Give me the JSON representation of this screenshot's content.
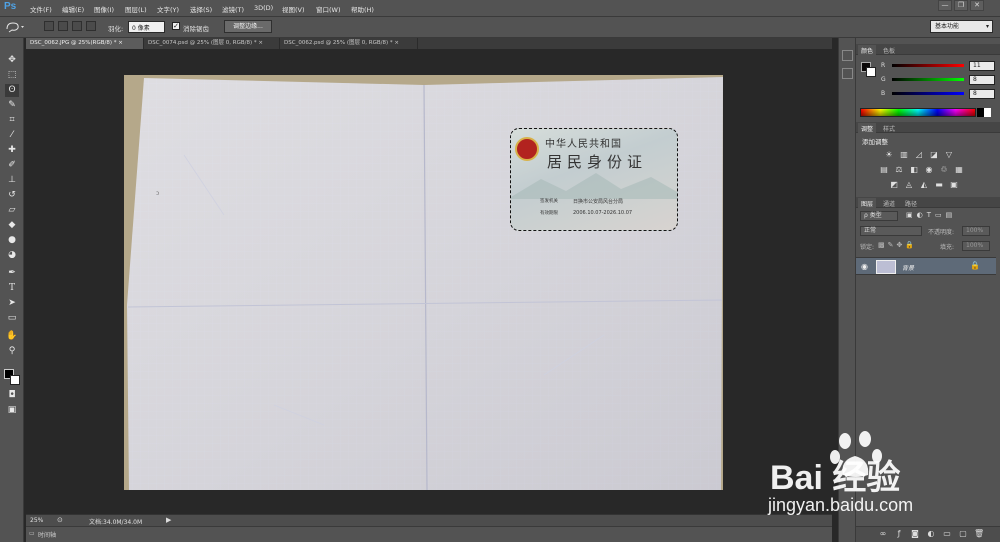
{
  "app": {
    "logo": "Ps"
  },
  "menubar": {
    "items": [
      "文件(F)",
      "编辑(E)",
      "图像(I)",
      "图层(L)",
      "文字(Y)",
      "选择(S)",
      "滤镜(T)",
      "3D(D)",
      "视图(V)",
      "窗口(W)",
      "帮助(H)"
    ],
    "window_controls": [
      "—",
      "❐",
      "✕"
    ]
  },
  "options": {
    "feather_label": "羽化:",
    "feather_value": "0 像素",
    "antialias_label": "消除锯齿",
    "antialias_checked": "✓",
    "refine_edge_label": "调整边缘...",
    "workspace": "基本功能"
  },
  "tabs": [
    {
      "label": "DSC_0062.JPG @ 25%(RGB/8) *",
      "close": "×"
    },
    {
      "label": "DSC_0074.psd @ 25% (图层 0, RGB/8) *",
      "close": "×"
    },
    {
      "label": "DSC_0062.psd @ 25% (图层 0, RGB/8) *",
      "close": "×"
    }
  ],
  "canvas": {
    "id_card": {
      "country": "中华人民共和国",
      "card_title": "居民身份证",
      "authority_label": "签发机关",
      "authority_value": "日换市公安局风台分局",
      "validity_label": "有效期限",
      "validity_value": "2006.10.07-2026.10.07"
    }
  },
  "status": {
    "zoom": "25%",
    "doc_size": "文档:34.0M/34.0M",
    "timeline_label": "时间轴"
  },
  "panels": {
    "color_tabs": [
      "颜色",
      "色板"
    ],
    "color": {
      "r_label": "R",
      "g_label": "G",
      "b_label": "B",
      "r": "11",
      "g": "8",
      "b": "8"
    },
    "adjust_tabs": [
      "调整",
      "样式"
    ],
    "add_adjustment": "添加调整",
    "layers_tabs": [
      "图层",
      "通道",
      "路径"
    ],
    "filter_kind": "ρ 类型",
    "blend_mode": "正常",
    "opacity_label": "不透明度:",
    "opacity_value": "100%",
    "lock_label": "锁定:",
    "fill_label": "填充:",
    "fill_value": "100%",
    "layer_name": "背景"
  },
  "watermark": {
    "brand": "Bai 经验",
    "url": "jingyan.baidu.com"
  },
  "colors": {
    "ui_bg": "#535353",
    "canvas_bg": "#282828",
    "ps_blue": "#4fa3e6",
    "layer_selected": "#5e6a78"
  }
}
